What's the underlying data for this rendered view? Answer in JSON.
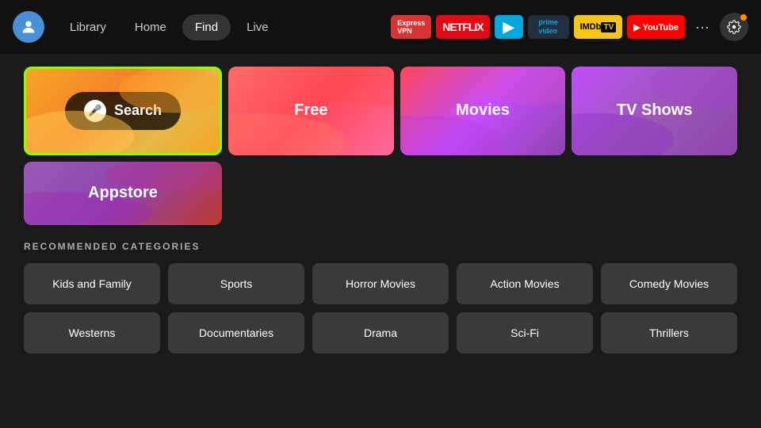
{
  "nav": {
    "avatar_icon": "👤",
    "links": [
      {
        "label": "Library",
        "active": false
      },
      {
        "label": "Home",
        "active": false
      },
      {
        "label": "Find",
        "active": true
      },
      {
        "label": "Live",
        "active": false
      }
    ],
    "apps": [
      {
        "id": "expressvpn",
        "label": "ExpressVPN",
        "class": "app-expressvpn"
      },
      {
        "id": "netflix",
        "label": "NETFLIX",
        "class": "app-netflix"
      },
      {
        "id": "freevee",
        "label": "▶",
        "class": "app-freevee"
      },
      {
        "id": "prime",
        "label": "prime video",
        "class": "app-prime"
      },
      {
        "id": "imdb",
        "label": "IMDb TV",
        "class": "app-imdb"
      },
      {
        "id": "youtube",
        "label": "▶ YouTube",
        "class": "app-youtube"
      }
    ],
    "more_label": "···",
    "settings_icon": "⚙"
  },
  "hero": {
    "search_label": "Search",
    "mic_icon": "🎤",
    "tiles": [
      {
        "id": "free",
        "label": "Free"
      },
      {
        "id": "movies",
        "label": "Movies"
      },
      {
        "id": "tvshows",
        "label": "TV Shows"
      },
      {
        "id": "appstore",
        "label": "Appstore"
      }
    ]
  },
  "categories": {
    "section_title": "RECOMMENDED CATEGORIES",
    "items": [
      {
        "label": "Kids and Family"
      },
      {
        "label": "Sports"
      },
      {
        "label": "Horror Movies"
      },
      {
        "label": "Action Movies"
      },
      {
        "label": "Comedy Movies"
      },
      {
        "label": "Westerns"
      },
      {
        "label": "Documentaries"
      },
      {
        "label": "Drama"
      },
      {
        "label": "Sci-Fi"
      },
      {
        "label": "Thrillers"
      }
    ]
  }
}
